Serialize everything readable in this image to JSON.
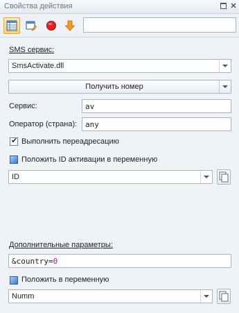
{
  "panel": {
    "title": "Свойства действия"
  },
  "toolbar": {
    "search_value": ""
  },
  "sms_service": {
    "section_label": "SMS сервис:",
    "selected_dll": "SmsActivate.dll",
    "get_number_button": "Получить номер"
  },
  "fields": {
    "service_label": "Сервис:",
    "service_value": "av",
    "operator_label": "Оператор (страна):",
    "operator_value": "any"
  },
  "options": {
    "redirect_label": "Выполнить переадресацию",
    "redirect_checked": true,
    "store_id_label": "Положить ID активации в переменную",
    "id_variable": "ID"
  },
  "extra": {
    "section_label": "Дополнительные параметры:",
    "params_prefix": "&country=",
    "params_number": "0",
    "store_var_label": "Положить в переменную",
    "var_name": "Numm"
  },
  "colors": {
    "accent_active": "#ffd36b",
    "number_token": "#a0199b"
  }
}
